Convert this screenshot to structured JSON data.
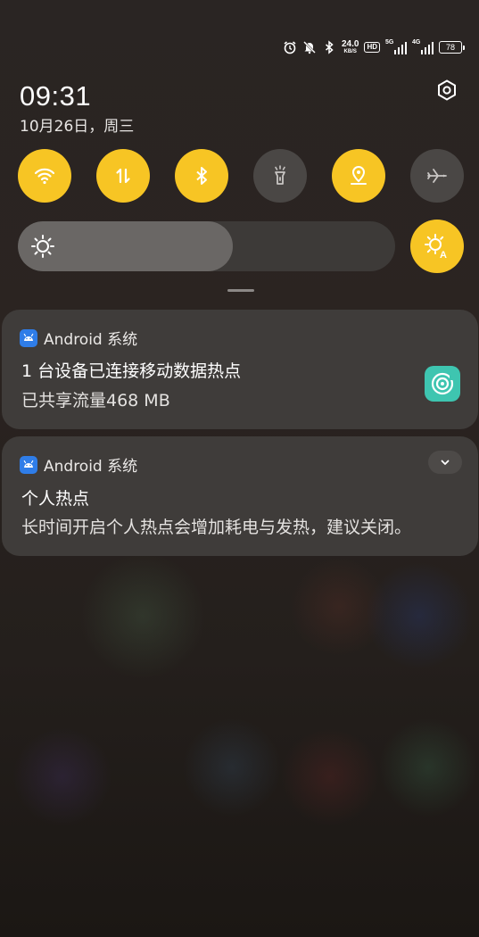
{
  "status_bar": {
    "icons": [
      "alarm-icon",
      "mute-icon",
      "bluetooth-icon"
    ],
    "net_speed_value": "24.0",
    "net_speed_unit": "KB/S",
    "hd_label": "HD",
    "sim1_label": "5G",
    "sim2_label": "4G",
    "battery": "78"
  },
  "header": {
    "time": "09:31",
    "date": "10月26日，周三"
  },
  "quick_tiles": [
    {
      "name": "wifi",
      "icon": "wifi-icon",
      "state": "on"
    },
    {
      "name": "mobile-data",
      "icon": "data-arrows-icon",
      "state": "on"
    },
    {
      "name": "bluetooth",
      "icon": "bluetooth-icon",
      "state": "on"
    },
    {
      "name": "flashlight",
      "icon": "flashlight-icon",
      "state": "off"
    },
    {
      "name": "location",
      "icon": "location-icon",
      "state": "on"
    },
    {
      "name": "airplane",
      "icon": "airplane-icon",
      "state": "off"
    }
  ],
  "brightness": {
    "level": 0.57,
    "auto_label": "A"
  },
  "notifications": [
    {
      "app": "Android 系统",
      "title": "1 台设备已连接移动数据热点",
      "text": "已共享流量468 MB"
    },
    {
      "app": "Android 系统",
      "title": "个人热点",
      "text": "长时间开启个人热点会增加耗电与发热，建议关闭。"
    }
  ],
  "colors": {
    "tile_on": "#f7c524",
    "tile_off": "#4a4745",
    "card_bg": "#3f3c3a",
    "hotspot_icon_bg": "#3ec5b0",
    "app_icon_bg": "#2f7de8"
  }
}
